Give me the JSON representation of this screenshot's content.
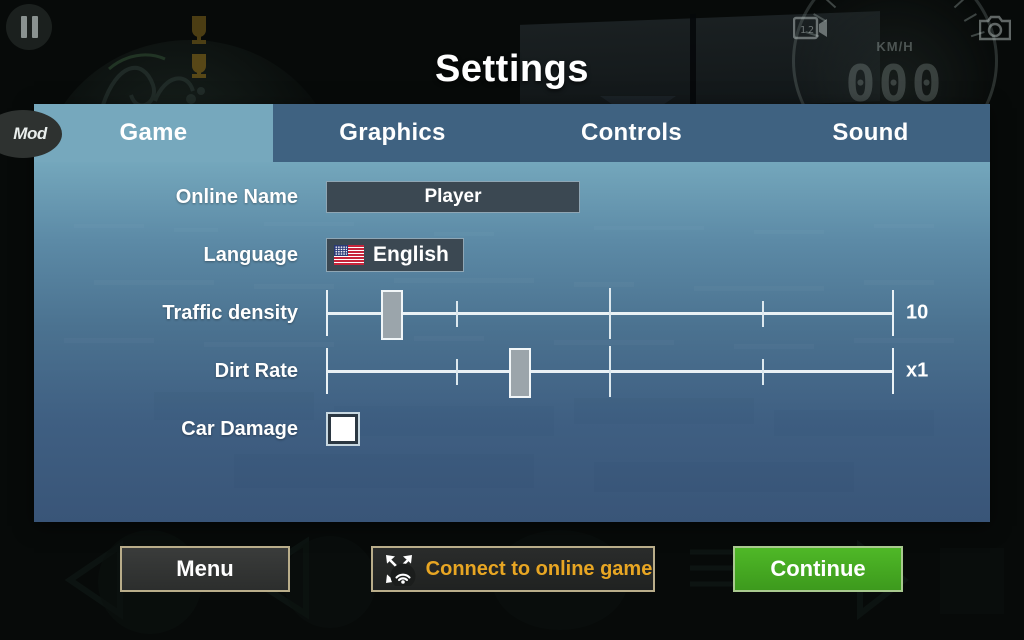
{
  "hud": {
    "pause_icon": "pause-icon",
    "mod_badge": "Mod",
    "camera_icon": "camera-icon",
    "video_icon": "video-camera-icon",
    "speedometer": {
      "unit": "KM/H",
      "value": "000"
    }
  },
  "header": {
    "title": "Settings"
  },
  "tabs": [
    {
      "label": "Game",
      "active": true
    },
    {
      "label": "Graphics",
      "active": false
    },
    {
      "label": "Controls",
      "active": false
    },
    {
      "label": "Sound",
      "active": false
    }
  ],
  "settings": {
    "online_name": {
      "label": "Online Name",
      "value": "Player",
      "placeholder": "Player"
    },
    "language": {
      "label": "Language",
      "value": "English",
      "flag": "us-flag-icon"
    },
    "traffic_density": {
      "label": "Traffic density",
      "value": "10",
      "thumb_percent": 11.6,
      "ticks_percent": [
        22.9,
        49.8,
        76.8
      ],
      "major_ticks_percent": [
        49.8
      ]
    },
    "dirt_rate": {
      "label": "Dirt Rate",
      "value": "x1",
      "thumb_percent": 34.2,
      "ticks_percent": [
        22.9,
        49.8,
        76.8
      ],
      "major_ticks_percent": [
        49.8
      ]
    },
    "car_damage": {
      "label": "Car Damage",
      "checked": true
    }
  },
  "footer": {
    "menu_label": "Menu",
    "connect_label": "Connect to online game",
    "connect_icon": "network-connect-icon",
    "continue_label": "Continue"
  },
  "colors": {
    "accent_blue": "#76a8bd",
    "tabbar_blue": "#3f6281",
    "gold_border": "#b9ad8a",
    "connect_text": "#e8a623",
    "continue_green": "#4fb827"
  }
}
